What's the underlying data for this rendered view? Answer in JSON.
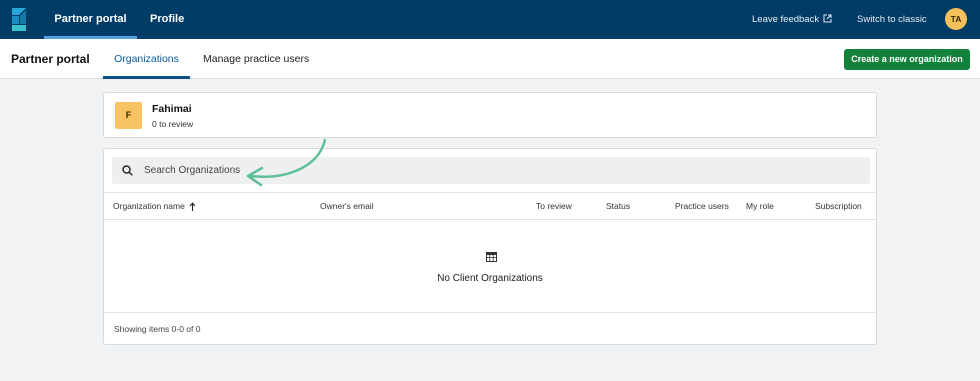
{
  "colors": {
    "topbar_bg": "#003c66",
    "accent_blue": "#0a5aa0",
    "create_button_bg": "#12823b",
    "avatar_bg": "#f6c15b",
    "annotation_arrow": "#5dbf96"
  },
  "topbar": {
    "logo_icon": "app-logo-icon",
    "nav": [
      {
        "label": "Partner portal",
        "active": true
      },
      {
        "label": "Profile",
        "active": false
      }
    ],
    "leave_feedback": "Leave feedback",
    "external_link_icon": "external-link-icon",
    "switch_to_classic": "Switch to classic",
    "user_initials": "TA"
  },
  "subbar": {
    "title": "Partner portal",
    "tabs": [
      {
        "label": "Organizations",
        "active": true
      },
      {
        "label": "Manage practice users",
        "active": false
      }
    ],
    "create_button": "Create a new organization"
  },
  "partner_card": {
    "initial": "F",
    "name": "Fahimai",
    "review_count": "0 to review"
  },
  "organizations": {
    "search_placeholder": "Search Organizations",
    "search_icon": "search-icon",
    "columns": [
      "Organization name",
      "Owner's email",
      "To review",
      "Status",
      "Practice users",
      "My role",
      "Subscription"
    ],
    "sort_icon": "arrow-up-icon",
    "empty_icon": "table-grid-icon",
    "empty_text": "No Client Organizations",
    "footer_text": "Showing items 0-0 of 0"
  }
}
